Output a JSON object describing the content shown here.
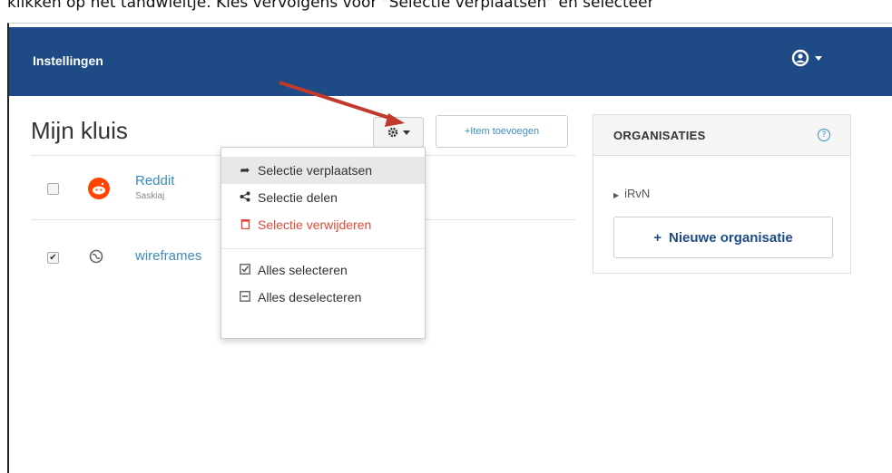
{
  "caption": "klikken op het tandwieltje. Kies vervolgens voor \"Selectie verplaatsen\" en selecteer",
  "navbar": {
    "settings_label": "Instellingen",
    "user_icon": "user-circle-icon"
  },
  "vault": {
    "title": "Mijn kluis",
    "add_item_label": "+Item toevoegen",
    "items": [
      {
        "name": "Reddit",
        "sub": "Saskiaj",
        "checked": false,
        "icon": "reddit-icon"
      },
      {
        "name": "wireframes",
        "sub": "",
        "checked": true,
        "icon": "globe-icon"
      }
    ]
  },
  "menu": {
    "items": [
      {
        "label": "Selectie verplaatsen",
        "icon": "share-arrow-icon",
        "active": true
      },
      {
        "label": "Selectie delen",
        "icon": "share-icon"
      },
      {
        "label": "Selectie verwijderen",
        "icon": "trash-icon",
        "danger": true
      },
      {
        "label": "Alles selecteren",
        "icon": "checkbox-checked-icon"
      },
      {
        "label": "Alles deselecteren",
        "icon": "checkbox-minus-icon"
      }
    ]
  },
  "organizations": {
    "title": "ORGANISATIES",
    "items": [
      "iRvN"
    ],
    "new_label": "Nieuwe organisatie"
  },
  "colors": {
    "navbar": "#1e4b86",
    "link": "#3c8dbc",
    "danger": "#dd4b39",
    "annotation_arrow": "#c0392b"
  }
}
